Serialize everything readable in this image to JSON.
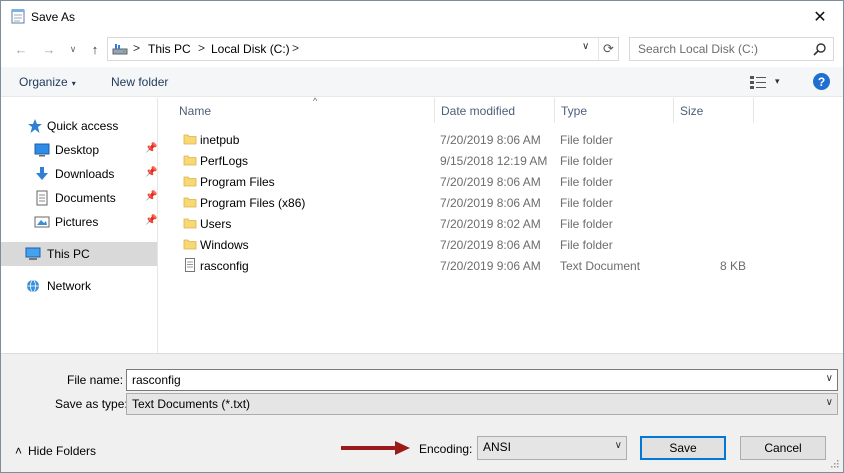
{
  "window": {
    "title": "Save As",
    "close_glyph": "✕"
  },
  "address": {
    "crumbs": [
      "This PC",
      "Local Disk (C:)"
    ],
    "separator": ">",
    "dropdown_glyph": "∨",
    "refresh_glyph": "⟳"
  },
  "nav_buttons": {
    "back": "←",
    "forward": "→",
    "dropdown": "∨",
    "up": "↑"
  },
  "search": {
    "placeholder": "Search Local Disk (C:)"
  },
  "toolbar": {
    "organize": "Organize",
    "new_folder": "New folder",
    "caret": "▾",
    "help": "?"
  },
  "navpane": {
    "items": [
      {
        "label": "Quick access",
        "icon": "star-icon",
        "pinned": false,
        "selected": false
      },
      {
        "label": "Desktop",
        "icon": "desktop-icon",
        "pinned": true,
        "selected": false
      },
      {
        "label": "Downloads",
        "icon": "download-icon",
        "pinned": true,
        "selected": false
      },
      {
        "label": "Documents",
        "icon": "documents-icon",
        "pinned": true,
        "selected": false
      },
      {
        "label": "Pictures",
        "icon": "pictures-icon",
        "pinned": true,
        "selected": false
      },
      {
        "label": "This PC",
        "icon": "computer-icon",
        "pinned": false,
        "selected": true
      },
      {
        "label": "Network",
        "icon": "network-icon",
        "pinned": false,
        "selected": false
      }
    ],
    "pin_glyph": "📌"
  },
  "list": {
    "columns": [
      "Name",
      "Date modified",
      "Type",
      "Size"
    ],
    "sort_glyph": "^",
    "rows": [
      {
        "name": "inetpub",
        "date": "7/20/2019 8:06 AM",
        "type": "File folder",
        "size": "",
        "kind": "folder"
      },
      {
        "name": "PerfLogs",
        "date": "9/15/2018 12:19 AM",
        "type": "File folder",
        "size": "",
        "kind": "folder"
      },
      {
        "name": "Program Files",
        "date": "7/20/2019 8:06 AM",
        "type": "File folder",
        "size": "",
        "kind": "folder"
      },
      {
        "name": "Program Files (x86)",
        "date": "7/20/2019 8:06 AM",
        "type": "File folder",
        "size": "",
        "kind": "folder"
      },
      {
        "name": "Users",
        "date": "7/20/2019 8:02 AM",
        "type": "File folder",
        "size": "",
        "kind": "folder"
      },
      {
        "name": "Windows",
        "date": "7/20/2019 8:06 AM",
        "type": "File folder",
        "size": "",
        "kind": "folder"
      },
      {
        "name": "rasconfig",
        "date": "7/20/2019 9:06 AM",
        "type": "Text Document",
        "size": "8 KB",
        "kind": "text"
      }
    ]
  },
  "form": {
    "file_name_label": "File name:",
    "file_name_value": "rasconfig",
    "save_type_label": "Save as type:",
    "save_type_value": "Text Documents (*.txt)",
    "hide_folders": "Hide Folders",
    "hide_glyph": "˄",
    "encoding_label": "Encoding:",
    "encoding_value": "ANSI",
    "save": "Save",
    "cancel": "Cancel",
    "dropdown_glyph": "∨"
  },
  "colors": {
    "accent": "#0078d7",
    "folder": "#f8d775",
    "arrow": "#9b1b1b",
    "selection": "#d9d9d9"
  }
}
